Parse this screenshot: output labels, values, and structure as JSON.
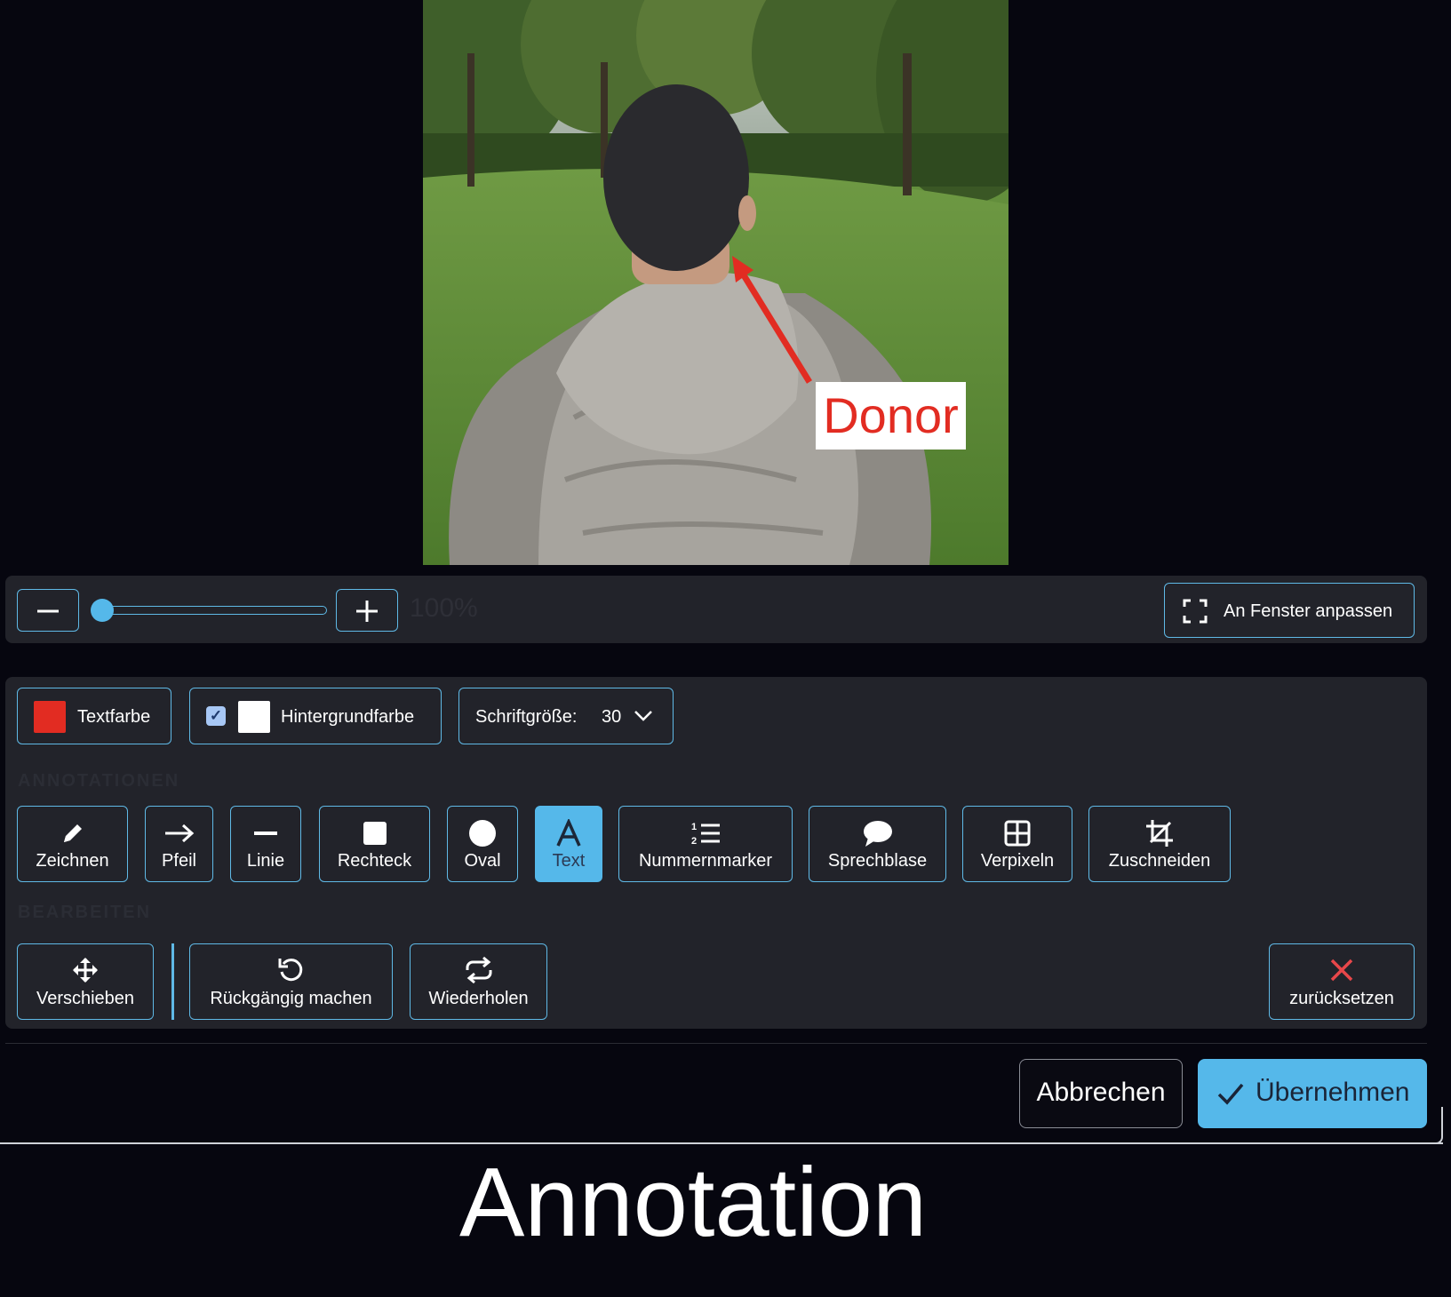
{
  "image": {
    "annotation_text": "Donor",
    "annotation_color": "#e22c22"
  },
  "zoom": {
    "minus_label": "−",
    "plus_label": "+",
    "value_label": "100%",
    "fit_label": "An Fenster anpassen",
    "slider_value": 0
  },
  "options": {
    "text_color_label": "Textfarbe",
    "text_color": "#e22c22",
    "background_color_label": "Hintergrundfarbe",
    "background_color": "#ffffff",
    "background_enabled": true,
    "font_size_label": "Schriftgröße:",
    "font_size_value": "30"
  },
  "sections": {
    "annotations": "ANNOTATIONEN",
    "edit": "BEARBEITEN"
  },
  "tools": [
    {
      "label": "Zeichnen",
      "icon": "pencil-icon"
    },
    {
      "label": "Pfeil",
      "icon": "arrow-right-icon"
    },
    {
      "label": "Linie",
      "icon": "line-icon"
    },
    {
      "label": "Rechteck",
      "icon": "rectangle-icon"
    },
    {
      "label": "Oval",
      "icon": "circle-icon"
    },
    {
      "label": "Text",
      "icon": "text-icon",
      "active": true
    },
    {
      "label": "Nummernmarker",
      "icon": "numbered-list-icon"
    },
    {
      "label": "Sprechblase",
      "icon": "speech-bubble-icon"
    },
    {
      "label": "Verpixeln",
      "icon": "grid-icon"
    },
    {
      "label": "Zuschneiden",
      "icon": "crop-icon"
    }
  ],
  "edit_actions": {
    "move": "Verschieben",
    "undo": "Rückgängig machen",
    "redo": "Wiederholen",
    "reset": "zurücksetzen"
  },
  "footer": {
    "cancel_label": "Abbrechen",
    "apply_label": "Übernehmen"
  },
  "caption": "Annotation",
  "colors": {
    "accent": "#55b8ea",
    "panel": "#22232a",
    "page": "#06060f",
    "reset_icon": "#e8474a"
  }
}
